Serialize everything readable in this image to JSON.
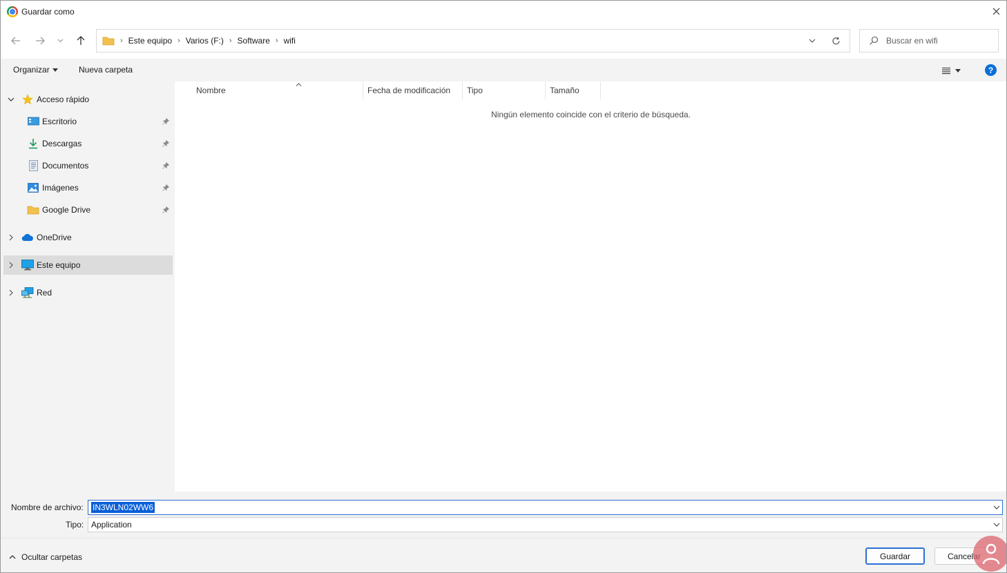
{
  "window": {
    "title": "Guardar como"
  },
  "address": {
    "crumbs": [
      "Este equipo",
      "Varios (F:)",
      "Software",
      "wifi"
    ]
  },
  "search": {
    "placeholder": "Buscar en wifi"
  },
  "toolbar": {
    "organize_label": "Organizar",
    "new_folder_label": "Nueva carpeta"
  },
  "sidebar": {
    "quick_access": {
      "label": "Acceso rápido",
      "icon": "star-icon"
    },
    "quick_items": [
      {
        "label": "Escritorio",
        "icon": "desktop-icon"
      },
      {
        "label": "Descargas",
        "icon": "download-icon"
      },
      {
        "label": "Documentos",
        "icon": "document-icon"
      },
      {
        "label": "Imágenes",
        "icon": "pictures-icon"
      },
      {
        "label": "Google Drive",
        "icon": "folder-icon"
      }
    ],
    "onedrive": {
      "label": "OneDrive",
      "icon": "cloud-icon"
    },
    "this_pc": {
      "label": "Este equipo",
      "icon": "monitor-icon",
      "selected": true
    },
    "network": {
      "label": "Red",
      "icon": "network-icon"
    }
  },
  "content": {
    "columns": [
      "Nombre",
      "Fecha de modificación",
      "Tipo",
      "Tamaño"
    ],
    "empty_message": "Ningún elemento coincide con el criterio de búsqueda."
  },
  "form": {
    "filename_label": "Nombre de archivo:",
    "filename_value": "IN3WLN02WW6",
    "type_label": "Tipo:",
    "type_value": "Application"
  },
  "footer": {
    "hide_folders_label": "Ocultar carpetas",
    "save_label": "Guardar",
    "cancel_label": "Cancelar"
  },
  "colors": {
    "accent": "#0a5fd8",
    "selected_bg": "#dcdcdc",
    "panel_bg": "#f3f3f3",
    "folder_yellow": "#f2c14e"
  }
}
